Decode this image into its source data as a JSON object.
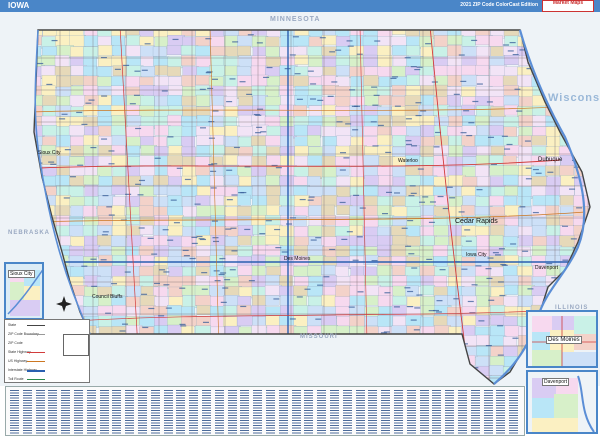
{
  "header": {
    "title": "IOWA",
    "edition": "2021 ZIP Code ColorCast Edition",
    "logo": "Market Maps"
  },
  "map": {
    "colors": {
      "border": "#555555",
      "header": "#4a86c8",
      "highway": "#d23c3c",
      "water": "#5b8ed6",
      "outside": "#eef3f7"
    },
    "palette": [
      "#b9e6f7",
      "#f7d9ef",
      "#d9ccf3",
      "#d7f0c9",
      "#fbf0c2",
      "#c9f1e7",
      "#f3d2c9",
      "#e6d9b9",
      "#cde0f7",
      "#f2e4f6"
    ],
    "cities": [
      {
        "key": "cedar-rapids",
        "name": "Cedar Rapids"
      },
      {
        "key": "dubuque",
        "name": "Dubuque"
      },
      {
        "key": "iowa-city",
        "name": "Iowa City"
      },
      {
        "key": "davenport",
        "name": "Davenport"
      },
      {
        "key": "council-bluffs",
        "name": "Council Bluffs"
      },
      {
        "key": "des-moines",
        "name": "Des Moines"
      },
      {
        "key": "waterloo",
        "name": "Waterloo"
      },
      {
        "key": "sioux-city",
        "name": "Sioux City"
      }
    ],
    "neighbors": [
      {
        "key": "minnesota",
        "name": "MINNESOTA"
      },
      {
        "key": "wisconsin",
        "name": "Wisconsin"
      },
      {
        "key": "illinois",
        "name": "ILLINOIS"
      },
      {
        "key": "missouri",
        "name": "MISSOURI"
      },
      {
        "key": "nebraska",
        "name": "NEBRASKA"
      }
    ]
  },
  "insets": {
    "sioux_city": "Sioux City",
    "des_moines": "Des Moines",
    "davenport": "Davenport"
  },
  "legend": {
    "items": [
      "State",
      "ZIP Code Boundary",
      "ZIP Code",
      "State Highway",
      "US Highway",
      "Interstate Highway",
      "Toll Route"
    ]
  }
}
